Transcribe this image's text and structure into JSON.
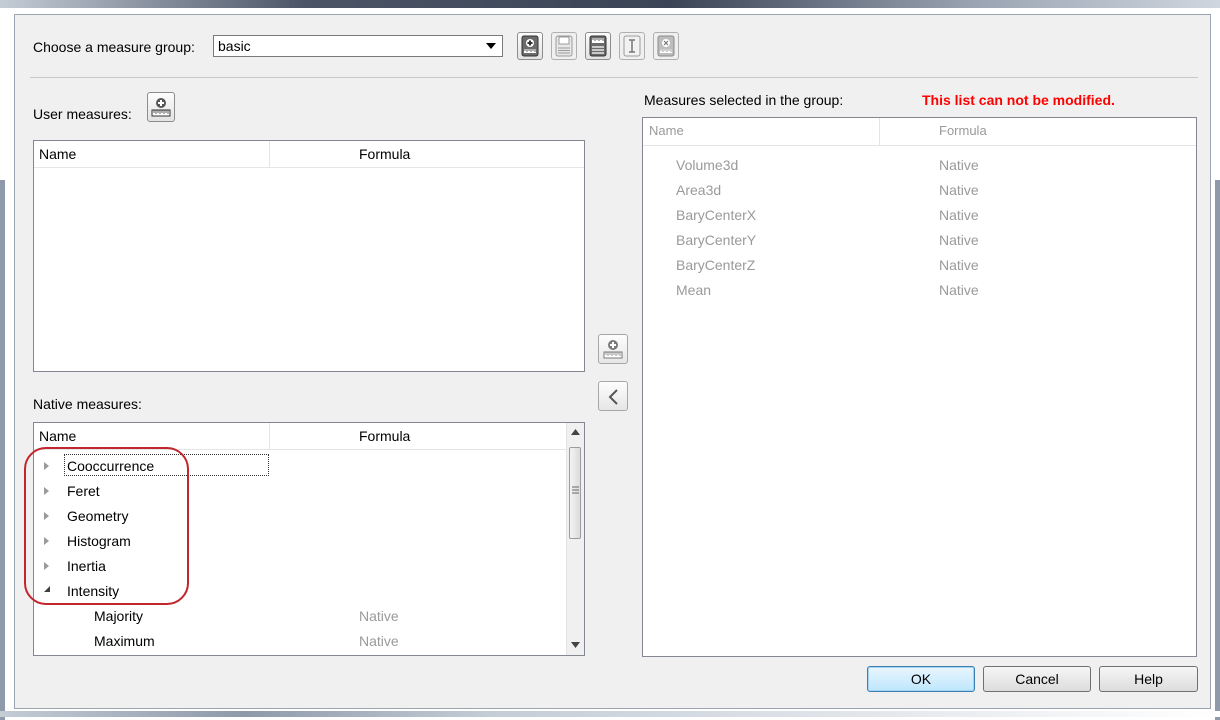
{
  "toolbar": {
    "measure_group_label": "Choose a measure group:",
    "measure_group_value": "basic",
    "buttons": [
      "new-group-icon",
      "save-icon",
      "save-as-icon",
      "rename-icon",
      "delete-group-icon"
    ]
  },
  "user_measures": {
    "label": "User measures:",
    "add_icon": "add-measure-icon",
    "columns": [
      "Name",
      "Formula"
    ],
    "rows": []
  },
  "native_measures": {
    "label": "Native measures:",
    "columns": [
      "Name",
      "Formula"
    ],
    "categories": [
      {
        "label": "Cooccurrence",
        "expanded": false
      },
      {
        "label": "Feret",
        "expanded": false
      },
      {
        "label": "Geometry",
        "expanded": false
      },
      {
        "label": "Histogram",
        "expanded": false
      },
      {
        "label": "Inertia",
        "expanded": false
      },
      {
        "label": "Intensity",
        "expanded": true
      }
    ],
    "children": [
      {
        "name": "Majority",
        "formula": "Native"
      },
      {
        "name": "Maximum",
        "formula": "Native"
      }
    ]
  },
  "selected_measures": {
    "label": "Measures selected in the group:",
    "warning": "This list can not be modified.",
    "columns": [
      "Name",
      "Formula"
    ],
    "rows": [
      {
        "name": "Volume3d",
        "formula": "Native"
      },
      {
        "name": "Area3d",
        "formula": "Native"
      },
      {
        "name": "BaryCenterX",
        "formula": "Native"
      },
      {
        "name": "BaryCenterY",
        "formula": "Native"
      },
      {
        "name": "BaryCenterZ",
        "formula": "Native"
      },
      {
        "name": "Mean",
        "formula": "Native"
      }
    ]
  },
  "transfer_buttons": [
    "add-to-group-icon",
    "chevron-left-icon"
  ],
  "footer": {
    "ok": "OK",
    "cancel": "Cancel",
    "help": "Help"
  },
  "colors": {
    "warning": "#ff0000",
    "annotation_oval": "#c0262c"
  }
}
